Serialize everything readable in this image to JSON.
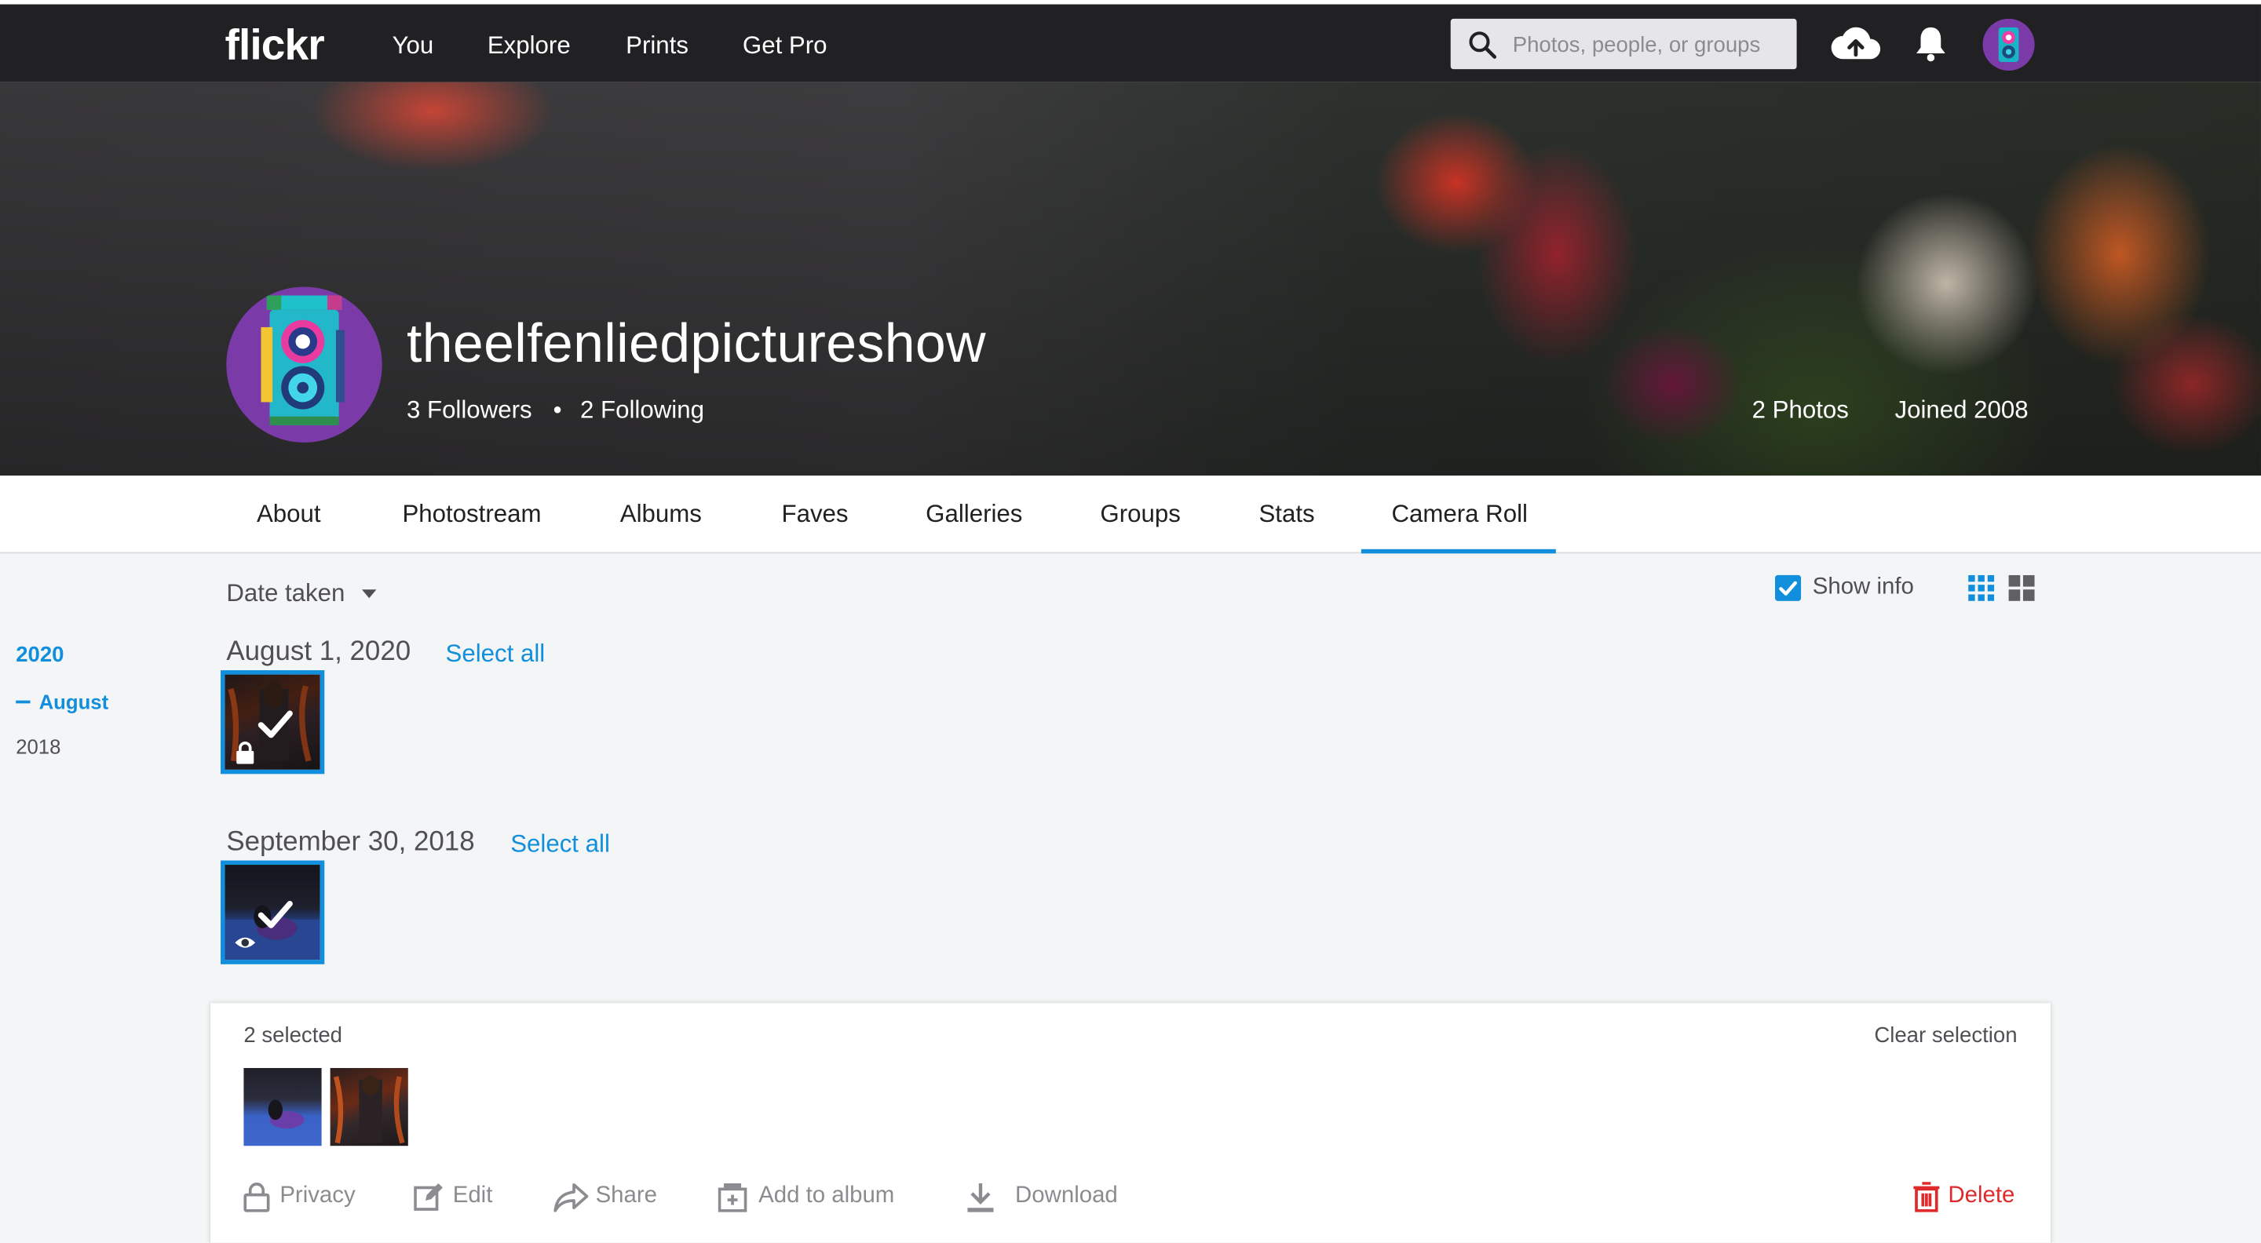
{
  "topbar": {
    "logo": "flickr",
    "nav": [
      "You",
      "Explore",
      "Prints",
      "Get Pro"
    ],
    "search_placeholder": "Photos, people, or groups"
  },
  "profile": {
    "username": "theelfenliedpictureshow",
    "followers": "3 Followers",
    "following": "2 Following",
    "separator": "•",
    "photos": "2 Photos",
    "joined": "Joined 2008"
  },
  "tabs": {
    "items": [
      "About",
      "Photostream",
      "Albums",
      "Faves",
      "Galleries",
      "Groups",
      "Stats",
      "Camera Roll"
    ],
    "active": "Camera Roll"
  },
  "controls": {
    "sort": "Date taken",
    "show_info": "Show info",
    "show_info_checked": true
  },
  "timeline": {
    "year_2020": "2020",
    "month_august": "August",
    "year_2018": "2018",
    "accent": "#128fdc"
  },
  "groups": [
    {
      "date": "August 1, 2020",
      "select_all": "Select all",
      "badge_icon": "lock-icon"
    },
    {
      "date": "September 30, 2018",
      "select_all": "Select all",
      "badge_icon": "eye-icon"
    }
  ],
  "selection": {
    "count": "2 selected",
    "clear": "Clear selection",
    "actions": {
      "privacy": "Privacy",
      "edit": "Edit",
      "share": "Share",
      "add_to_album": "Add to album",
      "download": "Download",
      "delete": "Delete"
    },
    "delete_color": "#e0292b"
  }
}
